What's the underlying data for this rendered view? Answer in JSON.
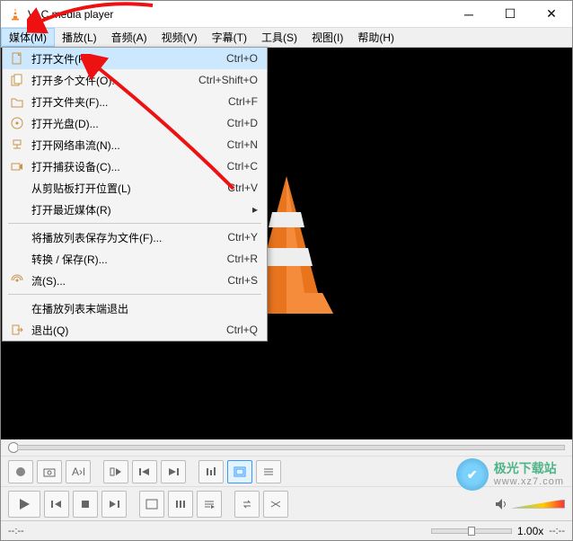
{
  "titlebar": {
    "title": "VLC media player"
  },
  "menubar": {
    "items": [
      {
        "label": "媒体(M)"
      },
      {
        "label": "播放(L)"
      },
      {
        "label": "音频(A)"
      },
      {
        "label": "视频(V)"
      },
      {
        "label": "字幕(T)"
      },
      {
        "label": "工具(S)"
      },
      {
        "label": "视图(I)"
      },
      {
        "label": "帮助(H)"
      }
    ]
  },
  "dropdown": {
    "items": [
      {
        "icon": "file",
        "label": "打开文件(F)...",
        "shortcut": "Ctrl+O",
        "highlight": true
      },
      {
        "icon": "files",
        "label": "打开多个文件(O)...",
        "shortcut": "Ctrl+Shift+O"
      },
      {
        "icon": "folder",
        "label": "打开文件夹(F)...",
        "shortcut": "Ctrl+F"
      },
      {
        "icon": "disc",
        "label": "打开光盘(D)...",
        "shortcut": "Ctrl+D"
      },
      {
        "icon": "network",
        "label": "打开网络串流(N)...",
        "shortcut": "Ctrl+N"
      },
      {
        "icon": "capture",
        "label": "打开捕获设备(C)...",
        "shortcut": "Ctrl+C"
      },
      {
        "icon": "",
        "label": "从剪贴板打开位置(L)",
        "shortcut": "Ctrl+V"
      },
      {
        "icon": "",
        "label": "打开最近媒体(R)",
        "shortcut": "",
        "submenu": true
      },
      {
        "sep": true
      },
      {
        "icon": "",
        "label": "将播放列表保存为文件(F)...",
        "shortcut": "Ctrl+Y"
      },
      {
        "icon": "",
        "label": "转换 / 保存(R)...",
        "shortcut": "Ctrl+R"
      },
      {
        "icon": "stream",
        "label": "流(S)...",
        "shortcut": "Ctrl+S"
      },
      {
        "sep": true
      },
      {
        "icon": "",
        "label": "在播放列表末端退出",
        "shortcut": ""
      },
      {
        "icon": "quit",
        "label": "退出(Q)",
        "shortcut": "Ctrl+Q"
      }
    ]
  },
  "status": {
    "time_left": "--:--",
    "speed": "1.00x",
    "time_right": "--:--"
  },
  "watermark": {
    "name": "极光下载站",
    "url": "www.xz7.com"
  }
}
